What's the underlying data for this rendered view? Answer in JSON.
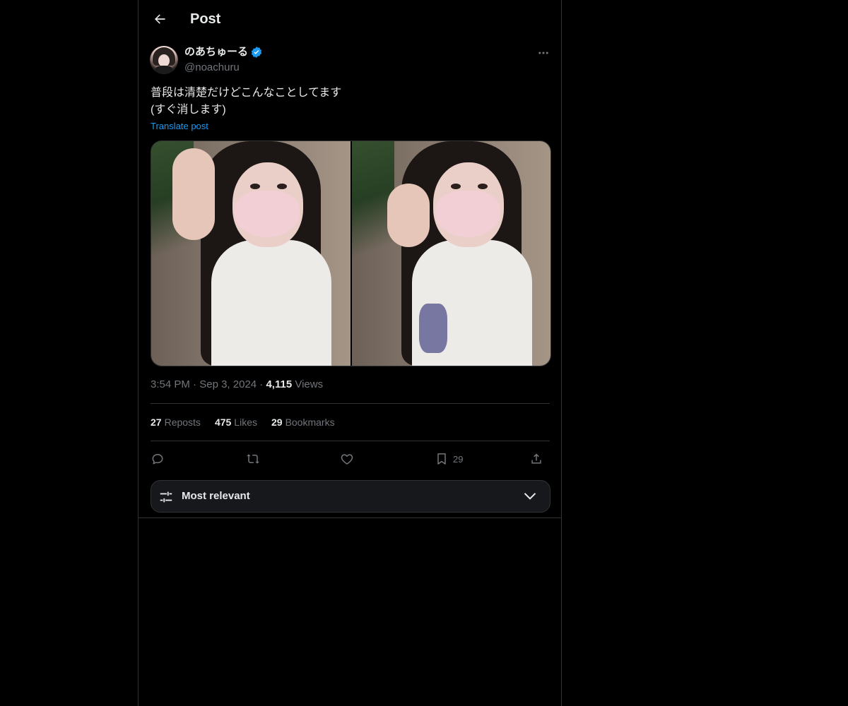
{
  "header": {
    "title": "Post"
  },
  "author": {
    "name": "のあちゅーる",
    "handle": "@noachuru",
    "verified": true
  },
  "post": {
    "text": "普段は清楚だけどこんなことしてます\n(すぐ消します)",
    "translate_label": "Translate post",
    "time": "3:54 PM",
    "date": "Sep 3, 2024",
    "views_count": "4,115",
    "views_label": "Views",
    "separator": "·"
  },
  "stats": {
    "reposts_count": "27",
    "reposts_label": "Reposts",
    "likes_count": "475",
    "likes_label": "Likes",
    "bookmarks_count": "29",
    "bookmarks_label": "Bookmarks"
  },
  "actions": {
    "bookmark_count": "29"
  },
  "sort": {
    "label": "Most relevant"
  },
  "colors": {
    "accent": "#1d9bf0",
    "background": "#000000",
    "muted": "#71767b",
    "text": "#e7e9ea"
  },
  "icons": [
    "back-arrow-icon",
    "verified-badge-icon",
    "more-icon",
    "reply-icon",
    "repost-icon",
    "like-icon",
    "bookmark-icon",
    "share-icon",
    "sliders-icon",
    "chevron-down-icon"
  ]
}
